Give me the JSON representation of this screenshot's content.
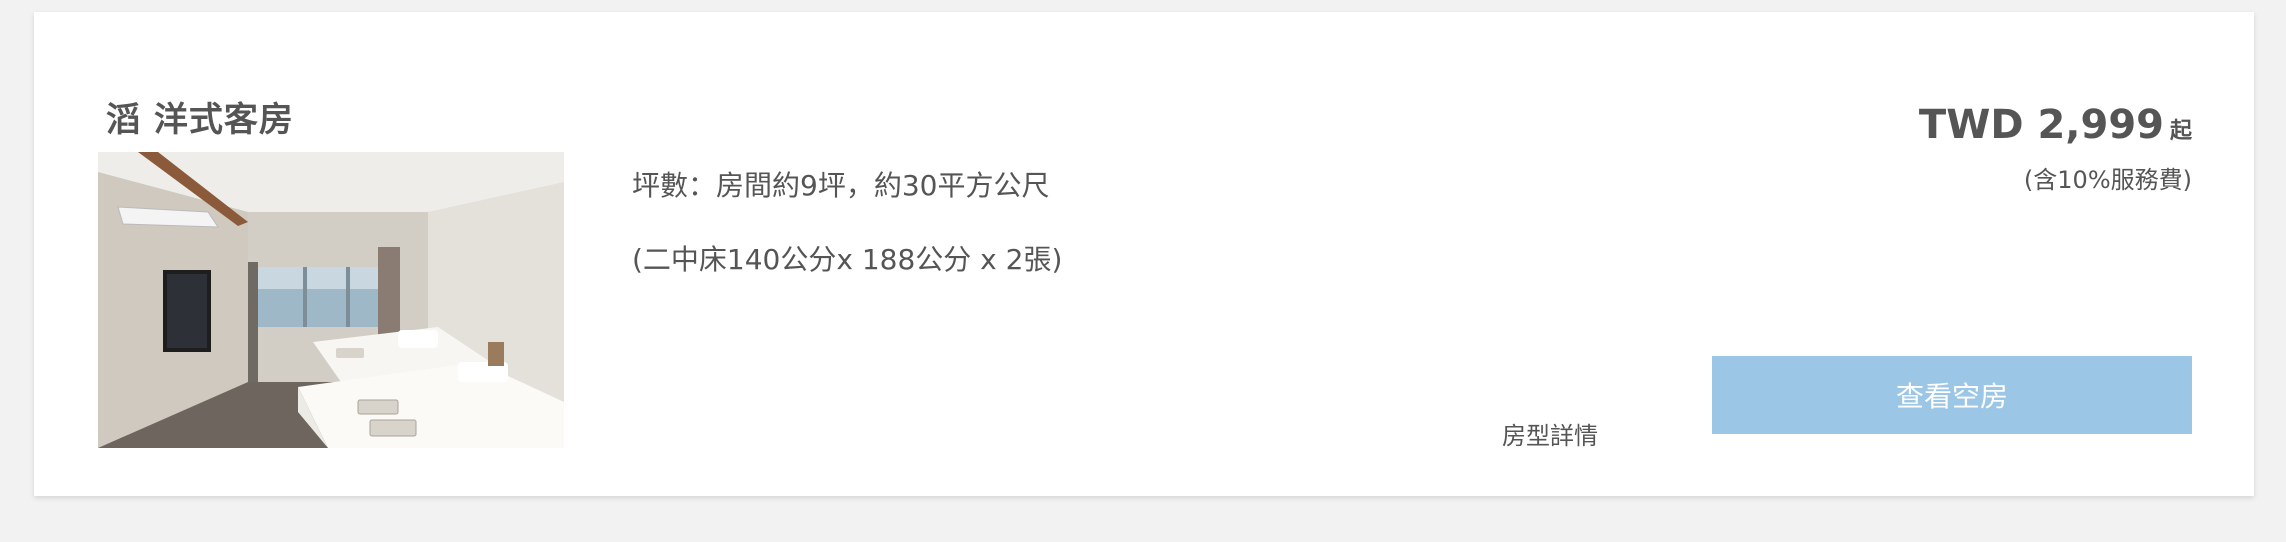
{
  "room": {
    "title": "滔 洋式客房",
    "photo_alt": "洋式客房",
    "size_text": "坪數：房間約9坪，約30平方公尺",
    "bed_text": "(二中床140公分x 188公分 x 2張)",
    "details_label": "房型詳情"
  },
  "pricing": {
    "amount": "TWD 2,999",
    "suffix": "起",
    "note": "(含10%服務費)"
  },
  "actions": {
    "view_availability_label": "查看空房"
  },
  "colors": {
    "accent_button": "#9cc6e5",
    "text": "#555555",
    "background": "#f2f2f2",
    "card": "#ffffff"
  }
}
